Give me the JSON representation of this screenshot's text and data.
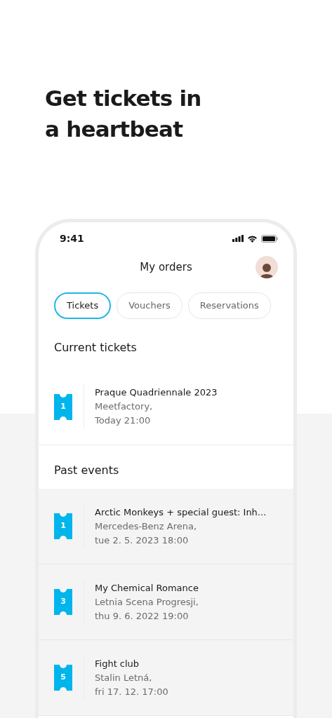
{
  "headline": "Get tickets in a heartbeat",
  "status_bar": {
    "time": "9:41"
  },
  "header": {
    "title": "My orders"
  },
  "tabs": [
    {
      "label": "Tickets",
      "selected": true
    },
    {
      "label": "Vouchers",
      "selected": false
    },
    {
      "label": "Reservations",
      "selected": false
    }
  ],
  "sections": [
    {
      "title": "Current tickets",
      "past": false,
      "orders": [
        {
          "count": "1",
          "name": "Praque Quadriennale 2023",
          "venue": "Meetfactory,",
          "date": "Today 21:00"
        }
      ]
    },
    {
      "title": "Past events",
      "past": true,
      "orders": [
        {
          "count": "1",
          "name": "Arctic Monkeys + special guest: Inh...",
          "venue": "Mercedes-Benz Arena,",
          "date": "tue 2. 5. 2023 18:00"
        },
        {
          "count": "3",
          "name": "My Chemical Romance",
          "venue": "Letnia Scena Progresji,",
          "date": "thu 9. 6. 2022 19:00"
        },
        {
          "count": "5",
          "name": "Fight club",
          "venue": "Stalin Letná,",
          "date": "fri 17. 12. 17:00"
        }
      ]
    }
  ]
}
